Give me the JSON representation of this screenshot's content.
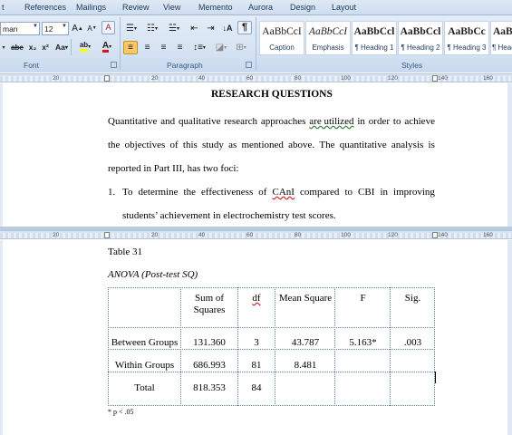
{
  "menu": {
    "tabs": [
      "t",
      "References",
      "Mailings",
      "Review",
      "View",
      "Memento",
      "Aurora",
      "Design",
      "Layout"
    ]
  },
  "font_group": {
    "font_name": "man",
    "font_size": "12",
    "grow_label": "A",
    "shrink_label": "A",
    "clear_format_label": "A",
    "strike_label": "abe",
    "subscript_label": "x₂",
    "superscript_label": "x²",
    "case_label": "Aa",
    "highlight_label": "ab",
    "fontcolor_label": "A",
    "label": "Font"
  },
  "paragraph_group": {
    "show_marks_label": "¶",
    "label": "Paragraph"
  },
  "styles_group": {
    "label": "Styles",
    "items": [
      {
        "sample": "AaBbCcI",
        "name": "Caption"
      },
      {
        "sample": "AaBbCcI",
        "name": "Emphasis"
      },
      {
        "sample": "AaBbCcl",
        "name": "¶ Heading 1"
      },
      {
        "sample": "AaBbCcl",
        "name": "¶ Heading 2"
      },
      {
        "sample": "AaBbCc",
        "name": "¶ Heading 3"
      },
      {
        "sample": "AaBl",
        "name": "¶ Head"
      }
    ]
  },
  "ruler": {
    "labels": [
      "20",
      "20",
      "40",
      "60",
      "80",
      "100",
      "120",
      "140",
      "160"
    ]
  },
  "document_top": {
    "heading": "RESEARCH QUESTIONS",
    "line1_words": [
      "Quantitative",
      "and",
      "qualitative",
      "research",
      "approaches",
      "are utilized",
      "in",
      "order",
      "to",
      "achieve"
    ],
    "line2_words": [
      "the",
      "objectives",
      "of",
      "this",
      "study",
      "as",
      "mentioned",
      "above.",
      "The",
      "quantitative",
      "analysis",
      "is"
    ],
    "line3": "reported in Part III, has two foci:",
    "list_number": "1.",
    "line4_words": [
      "To",
      "determine",
      "the",
      "effectiveness",
      "of",
      "CAnI",
      "compared",
      "to",
      "CBI",
      "in",
      "improving"
    ],
    "line5": "students’ achievement in electrochemistry test scores."
  },
  "document_bottom": {
    "table_caption": "Table 31",
    "table_title": "ANOVA (Post-test SQ)",
    "headers": [
      "Sum of\nSquares",
      "df",
      "Mean Square",
      "F",
      "Sig."
    ],
    "header_sum_line1": "Sum of",
    "header_sum_line2": "Squares",
    "rows": [
      {
        "label": "Between Groups",
        "sum": "131.360",
        "df": "3",
        "mean": "43.787",
        "f": "5.163*",
        "sig": ".003"
      },
      {
        "label": "Within Groups",
        "sum": "686.993",
        "df": "81",
        "mean": "8.481",
        "f": "",
        "sig": ""
      },
      {
        "label": "Total",
        "sum": "818.353",
        "df": "84",
        "mean": "",
        "f": "",
        "sig": ""
      }
    ],
    "footnote": "* p < .05"
  },
  "colors": {
    "ribbon": "#d6e3f2",
    "accent_pressed": "#f7c768",
    "table_gridline": "#5c7fa6"
  }
}
